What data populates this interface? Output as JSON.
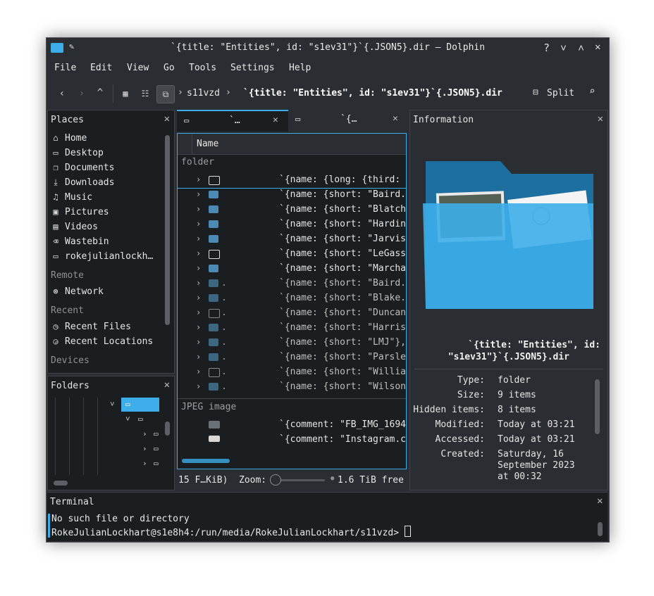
{
  "window": {
    "title": "`{title: \"Entities\", id: \"s1ev31\"}`{.JSON5}.dir — Dolphin",
    "controls": [
      "?",
      "˅",
      "˄",
      "✕"
    ]
  },
  "menu": [
    "File",
    "Edit",
    "View",
    "Go",
    "Tools",
    "Settings",
    "Help"
  ],
  "toolbar": {
    "breadcrumb_parent": "s11vzd",
    "breadcrumb_current": "`{title: \"Entities\", id: \"s1ev31\"}`{.JSON5}.dir",
    "split_label": "Split"
  },
  "places": {
    "header": "Places",
    "items": [
      {
        "label": "Home",
        "icon": "home-icon"
      },
      {
        "label": "Desktop",
        "icon": "desktop-icon"
      },
      {
        "label": "Documents",
        "icon": "documents-icon"
      },
      {
        "label": "Downloads",
        "icon": "downloads-icon"
      },
      {
        "label": "Music",
        "icon": "music-icon"
      },
      {
        "label": "Pictures",
        "icon": "pictures-icon"
      },
      {
        "label": "Videos",
        "icon": "videos-icon"
      },
      {
        "label": "Wastebin",
        "icon": "wastebin-icon"
      },
      {
        "label": "rokejulianlockh…",
        "icon": "folder-icon"
      }
    ],
    "remote_header": "Remote",
    "remote_items": [
      {
        "label": "Network",
        "icon": "network-icon"
      }
    ],
    "recent_header": "Recent",
    "recent_items": [
      {
        "label": "Recent Files",
        "icon": "recent-files-icon"
      },
      {
        "label": "Recent Locations",
        "icon": "recent-locations-icon"
      }
    ],
    "devices_header": "Devices"
  },
  "folders": {
    "header": "Folders"
  },
  "tabs": [
    {
      "label": "`…",
      "active": true
    },
    {
      "label": "`{…",
      "active": false
    }
  ],
  "file_view": {
    "column_header": "Name",
    "group_folder": "folder",
    "rows": [
      {
        "name": "`{name: {long: {third:",
        "icon": "folder",
        "dim": false
      },
      {
        "name": "`{name: {short: \"Baird.",
        "icon": "image",
        "dim": false
      },
      {
        "name": "`{name: {short: \"Blatch",
        "icon": "image",
        "dim": false
      },
      {
        "name": "`{name: {short: \"Hardin",
        "icon": "image",
        "dim": false
      },
      {
        "name": "`{name: {short: \"Jarvis",
        "icon": "image",
        "dim": false
      },
      {
        "name": "`{name: {short: \"LeGass",
        "icon": "folder",
        "dim": false
      },
      {
        "name": "`{name: {short: \"Marcha",
        "icon": "image",
        "dim": false
      },
      {
        "name": "`{name: {short: \"Baird.",
        "icon": "image",
        "dim": true
      },
      {
        "name": "`{name: {short: \"Blake.",
        "icon": "image",
        "dim": true
      },
      {
        "name": "`{name: {short: \"Duncan",
        "icon": "folder",
        "dim": true
      },
      {
        "name": "`{name: {short: \"Harris",
        "icon": "image",
        "dim": true
      },
      {
        "name": "`{name: {short: \"LMJ\"},",
        "icon": "image",
        "dim": true
      },
      {
        "name": "`{name: {short: \"Parsle",
        "icon": "image",
        "dim": true
      },
      {
        "name": "`{name: {short: \"Willia",
        "icon": "folder",
        "dim": true
      },
      {
        "name": "`{name: {short: \"Wilson",
        "icon": "image",
        "dim": true
      }
    ],
    "group_jpeg": "JPEG image",
    "jpeg_rows": [
      {
        "name": "`{comment: \"FB_IMG_1694"
      },
      {
        "name": "`{comment: \"Instagram.c"
      }
    ]
  },
  "statusbar": {
    "summary": "15 F…KiB)",
    "zoom_label": "Zoom:",
    "free_space": "1.6 TiB free",
    "zoom_level": 0.05
  },
  "information": {
    "header": "Information",
    "name_line1": "`{title: \"Entities\", id:",
    "name_line2": "\"s1ev31\"}`{.JSON5}.dir",
    "fields": [
      {
        "label": "Type:",
        "value": "folder"
      },
      {
        "label": "Size:",
        "value": "9 items"
      },
      {
        "label": "Hidden items:",
        "value": "8 items"
      },
      {
        "label": "Modified:",
        "value": "Today at 03:21"
      },
      {
        "label": "Accessed:",
        "value": "Today at 03:21"
      },
      {
        "label": "Created:",
        "value": "Saturday, 16"
      }
    ],
    "created_cont1": "September 2023",
    "created_cont2": "at 00:32"
  },
  "terminal": {
    "header": "Terminal",
    "line1": "No such file or directory",
    "prompt": "RokeJulianLockhart@s1e8h4:/run/media/RokeJulianLockhart/s11vzd>"
  },
  "colors": {
    "accent": "#3daee9",
    "window_bg": "#2a2e32",
    "view_bg": "#1b1e20",
    "folder_blue": "#3daee9"
  }
}
